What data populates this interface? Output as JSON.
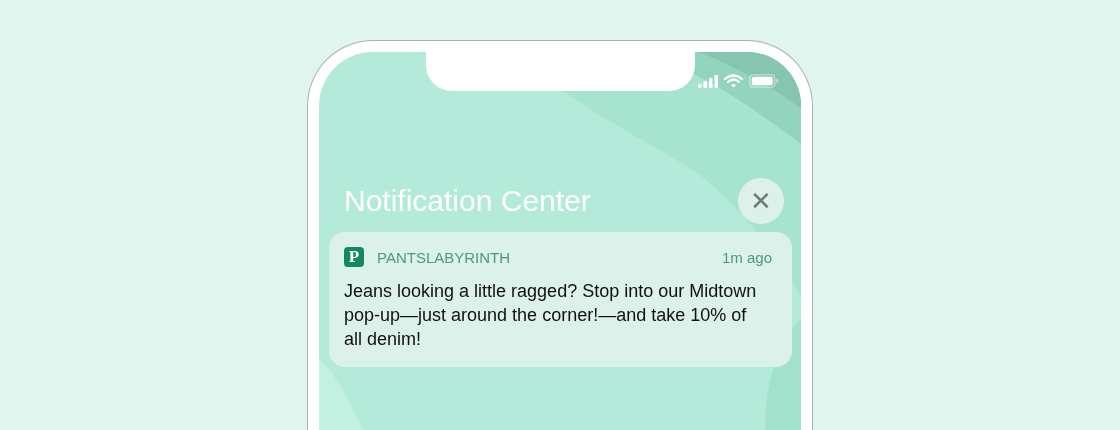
{
  "notification_center": {
    "title": "Notification Center",
    "close_label": "✕"
  },
  "notification": {
    "app_icon_letter": "P",
    "app_name": "PANTSLABYRINTH",
    "time": "1m ago",
    "message": "Jeans looking a little ragged? Stop into our Midtown pop-up—just around the corner!—and take 10% of all denim!"
  }
}
